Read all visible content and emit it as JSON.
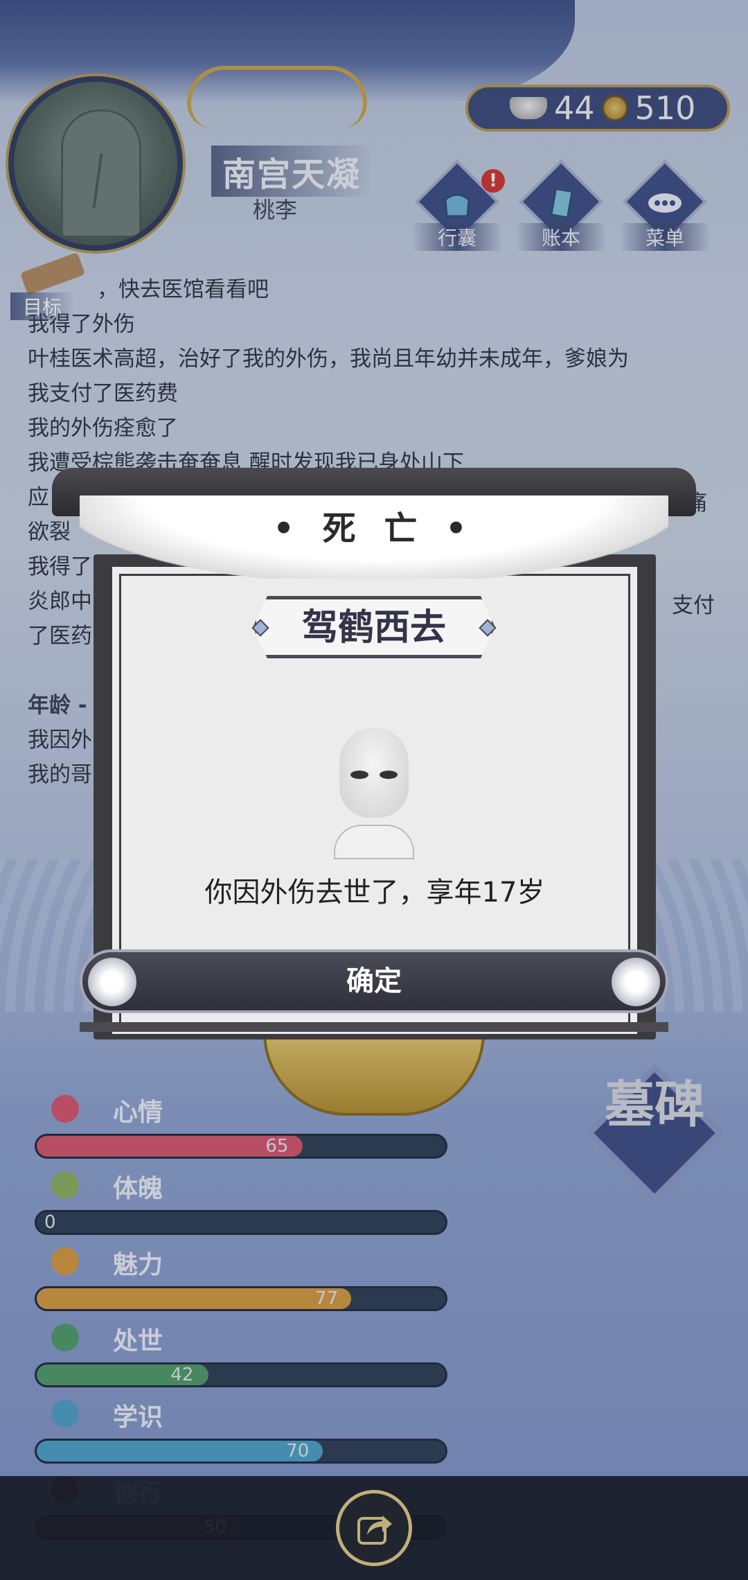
{
  "header": {
    "player_name": "南宫天凝",
    "player_subtitle": "桃李",
    "currency": {
      "ingots": "44",
      "coins": "510"
    },
    "buttons": [
      {
        "label": "行囊",
        "icon": "bag-icon",
        "alert": "!"
      },
      {
        "label": "账本",
        "icon": "ledger-icon"
      },
      {
        "label": "菜单",
        "icon": "menu-dots-icon"
      }
    ]
  },
  "goal": {
    "label": "目标",
    "text": "，快去医馆看看吧"
  },
  "log": {
    "lines": [
      "我得了外伤",
      "叶桂医术高超，治好了我的外伤，我尚且年幼并未成年，爹娘为",
      "我支付了医药费",
      "我的外伤痊愈了",
      "我遭受棕熊袭击奄奄息 醒时发现我已身处山下",
      "应",
      "欲裂",
      "我得了",
      "炎郎中",
      "了医药"
    ],
    "right_fragments": [
      "痛",
      "支付"
    ],
    "age_heading": "年龄 -",
    "age_lines": [
      "我因外",
      "我的哥"
    ]
  },
  "stats": [
    {
      "name": "心情",
      "value": 65,
      "max": 100,
      "color": "#d8566d",
      "icon": "flower-icon"
    },
    {
      "name": "体魄",
      "value": 0,
      "max": 100,
      "color": "#8fb05f",
      "icon": "hydrant-icon"
    },
    {
      "name": "魅力",
      "value": 77,
      "max": 100,
      "color": "#d89b3f",
      "icon": "jade-icon"
    },
    {
      "name": "处世",
      "value": 42,
      "max": 100,
      "color": "#4f9d6a",
      "icon": "hat-icon"
    },
    {
      "name": "学识",
      "value": 70,
      "max": 100,
      "color": "#4ea2c8",
      "icon": "books-icon"
    },
    {
      "name": "德行",
      "value": 50,
      "max": 100,
      "color": "#7a3a6a",
      "icon": "medal-icon"
    }
  ],
  "tomb_button": {
    "label": "墓碑"
  },
  "modal": {
    "title": "• 死 亡 •",
    "banner": "驾鹤西去",
    "message": "你因外伤去世了，享年17岁",
    "confirm": "确定"
  }
}
